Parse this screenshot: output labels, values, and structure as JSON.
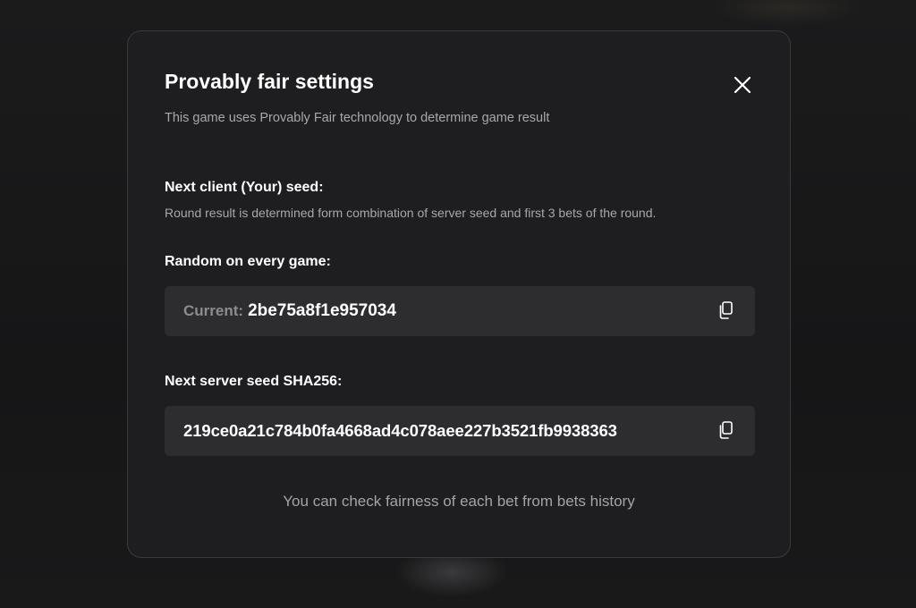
{
  "dialog": {
    "title": "Provably fair settings",
    "subtitle": "This game uses Provably Fair technology to determine game result",
    "close_icon": "close-icon"
  },
  "client_seed": {
    "heading": "Next client (Your) seed:",
    "description": "Round result is determined form combination of server seed and first 3 bets of the round.",
    "mode_label": "Random on every game:",
    "current_label": "Current:",
    "current_value": "2be75a8f1e957034",
    "copy_icon": "copy-icon"
  },
  "server_seed": {
    "heading": "Next server seed SHA256:",
    "value": "219ce0a21c784b0fa4668ad4c078aee227b3521fb9938363",
    "copy_icon": "copy-icon"
  },
  "footer": {
    "note": "You can check fairness of each bet from bets history"
  },
  "colors": {
    "page_background": "#181819",
    "modal_background": "#1e1e20",
    "field_background": "#2d2d30",
    "primary_text": "#ffffff",
    "secondary_text": "#a8a8ab"
  }
}
